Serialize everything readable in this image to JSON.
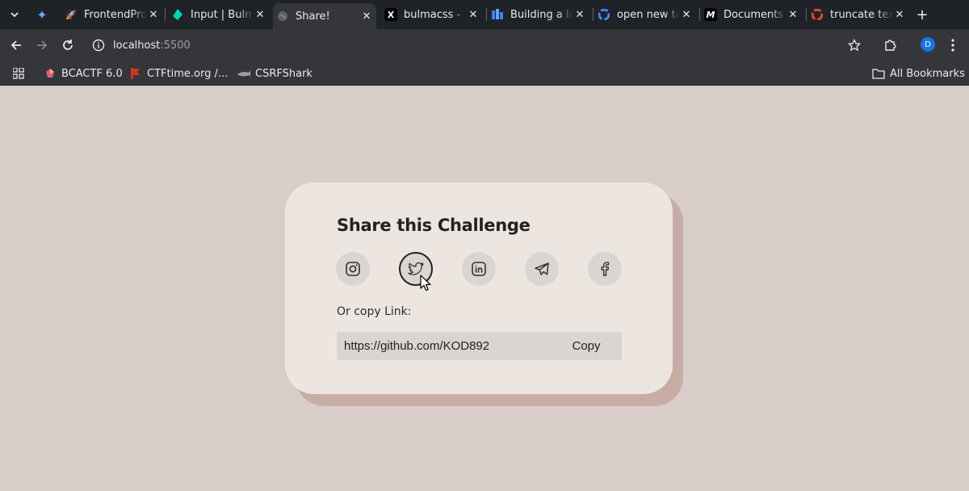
{
  "browser": {
    "tabs": [
      {
        "title": "FrontendPro",
        "favicon": "rocket-icon",
        "active": false
      },
      {
        "title": "Input | Bulma",
        "favicon": "bulma-icon",
        "active": false
      },
      {
        "title": "Share!",
        "favicon": "globe-icon",
        "active": true
      },
      {
        "title": "bulmacss - ",
        "favicon": "x-icon",
        "active": false
      },
      {
        "title": "Building a la",
        "favicon": "tailwind-icon",
        "active": false
      },
      {
        "title": "open new ta",
        "favicon": "google-icon",
        "active": false
      },
      {
        "title": "Documents",
        "favicon": "m-icon",
        "active": false
      },
      {
        "title": "truncate text",
        "favicon": "google-icon",
        "active": false
      }
    ],
    "close_glyph": "✕",
    "new_tab_glyph": "+",
    "url_host": "localhost",
    "url_port": ":5500",
    "profile_initial": "D",
    "bookmarks": [
      {
        "label": "BCACTF 6.0",
        "icon": "bcactf-icon"
      },
      {
        "label": "CTFtime.org /...",
        "icon": "ctftime-icon"
      },
      {
        "label": "CSRFShark",
        "icon": "shark-icon"
      }
    ],
    "all_bookmarks": "All Bookmarks"
  },
  "share_card": {
    "title": "Share this Challenge",
    "social_buttons": [
      {
        "name": "instagram",
        "icon": "instagram-icon"
      },
      {
        "name": "twitter",
        "icon": "twitter-icon",
        "hovered": true
      },
      {
        "name": "linkedin",
        "icon": "linkedin-icon"
      },
      {
        "name": "telegram",
        "icon": "telegram-icon"
      },
      {
        "name": "facebook",
        "icon": "facebook-icon"
      }
    ],
    "copy_label": "Or copy Link:",
    "link_value": "https://github.com/KOD892",
    "copy_button": "Copy"
  },
  "colors": {
    "page_bg": "#d9cdc9",
    "card_bg": "#ede6e0",
    "card_shadow": "#c7ada6",
    "icon_bg": "#d8d5d2"
  }
}
